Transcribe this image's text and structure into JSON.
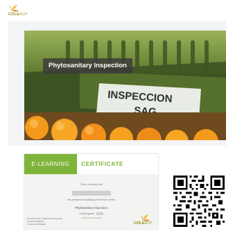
{
  "header": {
    "logo": {
      "name": "COLEACP",
      "text_main": "COLE",
      "text_accent": "ACP"
    }
  },
  "course": {
    "title": "Phytosanitary Inspection",
    "image_text": [
      "INSPECCION",
      "SAG"
    ]
  },
  "certificate": {
    "heading_left": "E-LEARNING",
    "heading_right": "CERTIFICATE",
    "certify_line": "This is to certify that",
    "passed_line": "has passed the qualifying test of the course",
    "course_name": "Phytosanitary Inspection",
    "score_label": "Overall grade:",
    "signature_line1": "On behalf of the COLEACP training team",
    "signature_line2": "Jeremie Knaflewski",
    "signature_line3": "Training unit Manager",
    "logo_text_main": "COLE",
    "logo_text_accent": "ACP"
  },
  "qr": {
    "icon": "qr-code-icon"
  },
  "colors": {
    "accent_green": "#7fb43a",
    "logo_olive": "#8a8f1a",
    "title_overlay": "#3a3a3a"
  }
}
